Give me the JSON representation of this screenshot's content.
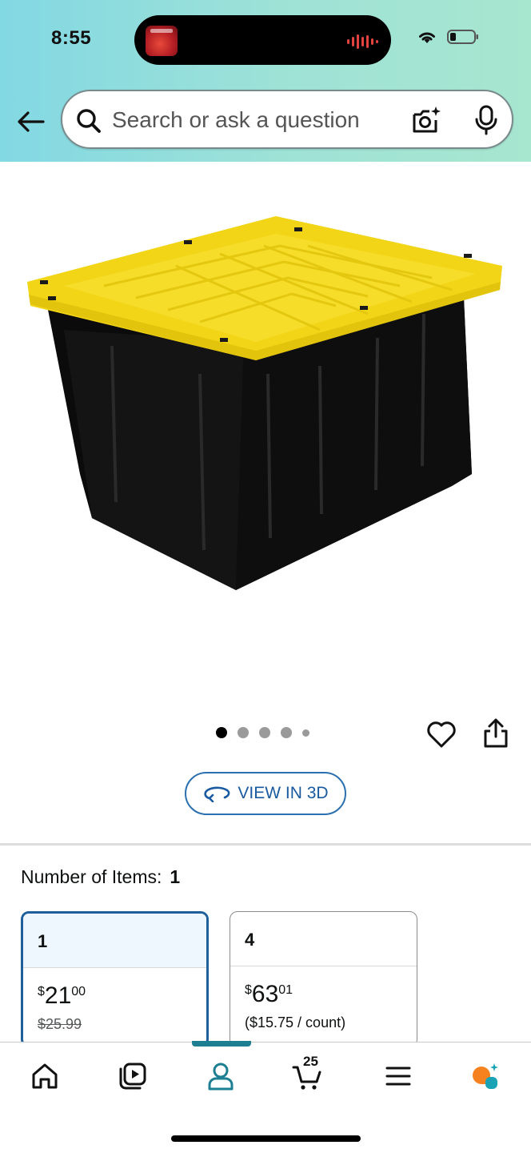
{
  "status_bar": {
    "time": "8:55",
    "icons": [
      "now-playing-artwork",
      "audio-waveform-icon",
      "wifi-icon",
      "battery-icon"
    ]
  },
  "header": {
    "back_icon": "back-arrow-icon",
    "search": {
      "placeholder": "Search or ask a question",
      "value": "",
      "icons": [
        "search-icon",
        "camera-search-icon",
        "microphone-icon"
      ]
    },
    "colors": {
      "gradient_start": "#82d8e3",
      "gradient_end": "#a7e6cf"
    }
  },
  "product": {
    "image_name": "black storage tote with yellow lid",
    "image_pager": {
      "count": 5,
      "active_index": 0
    },
    "actions": [
      "heart-icon",
      "share-icon"
    ],
    "view_3d_label": "VIEW IN 3D"
  },
  "quantity": {
    "label": "Number of Items:",
    "selected_value": "1",
    "options": [
      {
        "count": "1",
        "price_whole": "21",
        "price_fraction": "00",
        "currency": "$",
        "list_price": "$25.99",
        "selected": true
      },
      {
        "count": "4",
        "price_whole": "63",
        "price_fraction": "01",
        "currency": "$",
        "unit_price": "($15.75 / count)",
        "selected": false
      }
    ],
    "colors": {
      "selected_border": "#1e5f9c",
      "selected_header_bg": "#edf7fd"
    }
  },
  "bottom_nav": {
    "items": [
      "home-icon",
      "video-icon",
      "account-icon",
      "cart-icon",
      "menu-icon",
      "rufus-assistant-icon"
    ],
    "active": "account-icon",
    "cart_count": "25",
    "colors": {
      "active_accent": "#1e7e92",
      "assistant_orange": "#f6821f",
      "assistant_teal": "#1aa3b5"
    }
  }
}
